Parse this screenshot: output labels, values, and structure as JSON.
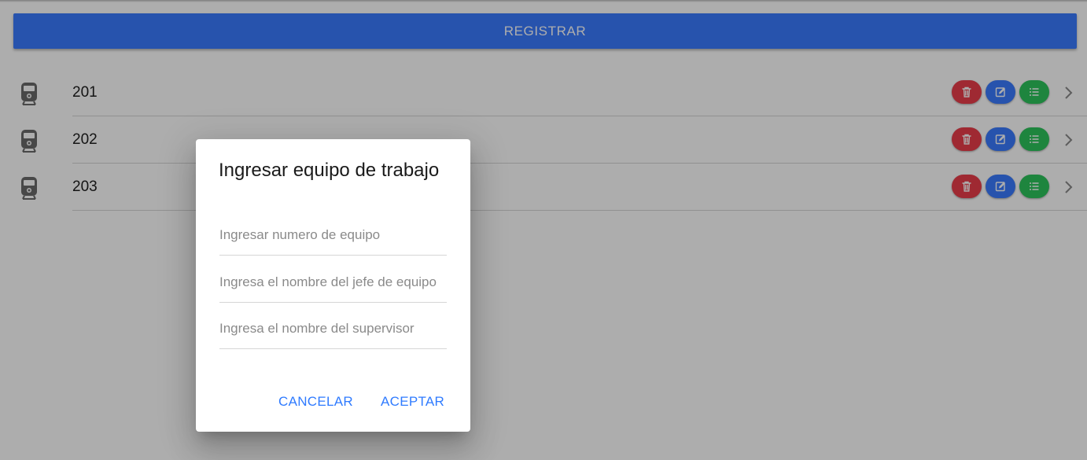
{
  "header": {
    "register_label": "REGISTRAR"
  },
  "colors": {
    "primary": "#3a7bff",
    "danger": "#eb3d4a",
    "info": "#3a7bff",
    "success": "#2dc55c",
    "dialog_button": "#2f7bff"
  },
  "teams": [
    {
      "label": "201",
      "icon": "train-icon"
    },
    {
      "label": "202",
      "icon": "train-icon"
    },
    {
      "label": "203",
      "icon": "train-icon"
    }
  ],
  "row_actions": {
    "delete_icon": "trash-icon",
    "edit_icon": "edit-icon",
    "list_icon": "list-icon",
    "detail_icon": "chevron-right-icon"
  },
  "dialog": {
    "title": "Ingresar equipo de trabajo",
    "fields": [
      {
        "placeholder": "Ingresar numero de equipo",
        "value": ""
      },
      {
        "placeholder": "Ingresa el nombre del jefe de equipo",
        "value": ""
      },
      {
        "placeholder": "Ingresa el nombre del supervisor",
        "value": ""
      }
    ],
    "cancel_label": "CANCELAR",
    "accept_label": "ACEPTAR"
  }
}
